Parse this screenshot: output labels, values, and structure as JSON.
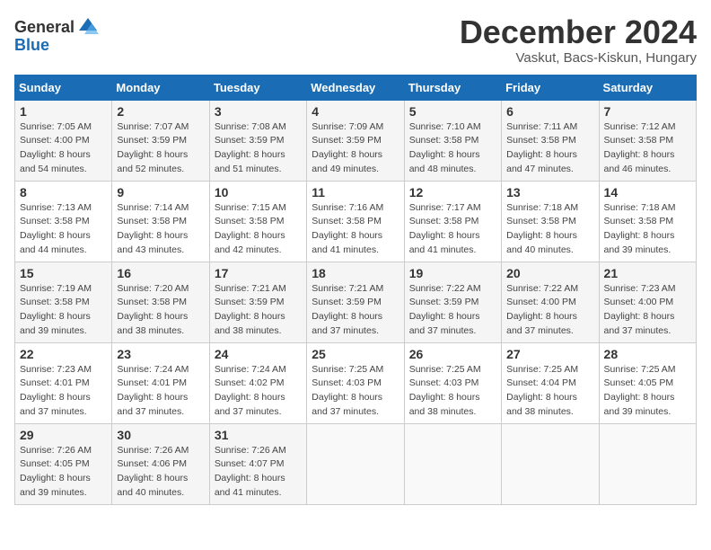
{
  "header": {
    "logo_general": "General",
    "logo_blue": "Blue",
    "month_title": "December 2024",
    "location": "Vaskut, Bacs-Kiskun, Hungary"
  },
  "calendar": {
    "weekdays": [
      "Sunday",
      "Monday",
      "Tuesday",
      "Wednesday",
      "Thursday",
      "Friday",
      "Saturday"
    ],
    "weeks": [
      [
        {
          "day": "1",
          "sunrise": "7:05 AM",
          "sunset": "4:00 PM",
          "daylight": "8 hours and 54 minutes."
        },
        {
          "day": "2",
          "sunrise": "7:07 AM",
          "sunset": "3:59 PM",
          "daylight": "8 hours and 52 minutes."
        },
        {
          "day": "3",
          "sunrise": "7:08 AM",
          "sunset": "3:59 PM",
          "daylight": "8 hours and 51 minutes."
        },
        {
          "day": "4",
          "sunrise": "7:09 AM",
          "sunset": "3:59 PM",
          "daylight": "8 hours and 49 minutes."
        },
        {
          "day": "5",
          "sunrise": "7:10 AM",
          "sunset": "3:58 PM",
          "daylight": "8 hours and 48 minutes."
        },
        {
          "day": "6",
          "sunrise": "7:11 AM",
          "sunset": "3:58 PM",
          "daylight": "8 hours and 47 minutes."
        },
        {
          "day": "7",
          "sunrise": "7:12 AM",
          "sunset": "3:58 PM",
          "daylight": "8 hours and 46 minutes."
        }
      ],
      [
        {
          "day": "8",
          "sunrise": "7:13 AM",
          "sunset": "3:58 PM",
          "daylight": "8 hours and 44 minutes."
        },
        {
          "day": "9",
          "sunrise": "7:14 AM",
          "sunset": "3:58 PM",
          "daylight": "8 hours and 43 minutes."
        },
        {
          "day": "10",
          "sunrise": "7:15 AM",
          "sunset": "3:58 PM",
          "daylight": "8 hours and 42 minutes."
        },
        {
          "day": "11",
          "sunrise": "7:16 AM",
          "sunset": "3:58 PM",
          "daylight": "8 hours and 41 minutes."
        },
        {
          "day": "12",
          "sunrise": "7:17 AM",
          "sunset": "3:58 PM",
          "daylight": "8 hours and 41 minutes."
        },
        {
          "day": "13",
          "sunrise": "7:18 AM",
          "sunset": "3:58 PM",
          "daylight": "8 hours and 40 minutes."
        },
        {
          "day": "14",
          "sunrise": "7:18 AM",
          "sunset": "3:58 PM",
          "daylight": "8 hours and 39 minutes."
        }
      ],
      [
        {
          "day": "15",
          "sunrise": "7:19 AM",
          "sunset": "3:58 PM",
          "daylight": "8 hours and 39 minutes."
        },
        {
          "day": "16",
          "sunrise": "7:20 AM",
          "sunset": "3:58 PM",
          "daylight": "8 hours and 38 minutes."
        },
        {
          "day": "17",
          "sunrise": "7:21 AM",
          "sunset": "3:59 PM",
          "daylight": "8 hours and 38 minutes."
        },
        {
          "day": "18",
          "sunrise": "7:21 AM",
          "sunset": "3:59 PM",
          "daylight": "8 hours and 37 minutes."
        },
        {
          "day": "19",
          "sunrise": "7:22 AM",
          "sunset": "3:59 PM",
          "daylight": "8 hours and 37 minutes."
        },
        {
          "day": "20",
          "sunrise": "7:22 AM",
          "sunset": "4:00 PM",
          "daylight": "8 hours and 37 minutes."
        },
        {
          "day": "21",
          "sunrise": "7:23 AM",
          "sunset": "4:00 PM",
          "daylight": "8 hours and 37 minutes."
        }
      ],
      [
        {
          "day": "22",
          "sunrise": "7:23 AM",
          "sunset": "4:01 PM",
          "daylight": "8 hours and 37 minutes."
        },
        {
          "day": "23",
          "sunrise": "7:24 AM",
          "sunset": "4:01 PM",
          "daylight": "8 hours and 37 minutes."
        },
        {
          "day": "24",
          "sunrise": "7:24 AM",
          "sunset": "4:02 PM",
          "daylight": "8 hours and 37 minutes."
        },
        {
          "day": "25",
          "sunrise": "7:25 AM",
          "sunset": "4:03 PM",
          "daylight": "8 hours and 37 minutes."
        },
        {
          "day": "26",
          "sunrise": "7:25 AM",
          "sunset": "4:03 PM",
          "daylight": "8 hours and 38 minutes."
        },
        {
          "day": "27",
          "sunrise": "7:25 AM",
          "sunset": "4:04 PM",
          "daylight": "8 hours and 38 minutes."
        },
        {
          "day": "28",
          "sunrise": "7:25 AM",
          "sunset": "4:05 PM",
          "daylight": "8 hours and 39 minutes."
        }
      ],
      [
        {
          "day": "29",
          "sunrise": "7:26 AM",
          "sunset": "4:05 PM",
          "daylight": "8 hours and 39 minutes."
        },
        {
          "day": "30",
          "sunrise": "7:26 AM",
          "sunset": "4:06 PM",
          "daylight": "8 hours and 40 minutes."
        },
        {
          "day": "31",
          "sunrise": "7:26 AM",
          "sunset": "4:07 PM",
          "daylight": "8 hours and 41 minutes."
        },
        null,
        null,
        null,
        null
      ]
    ]
  }
}
